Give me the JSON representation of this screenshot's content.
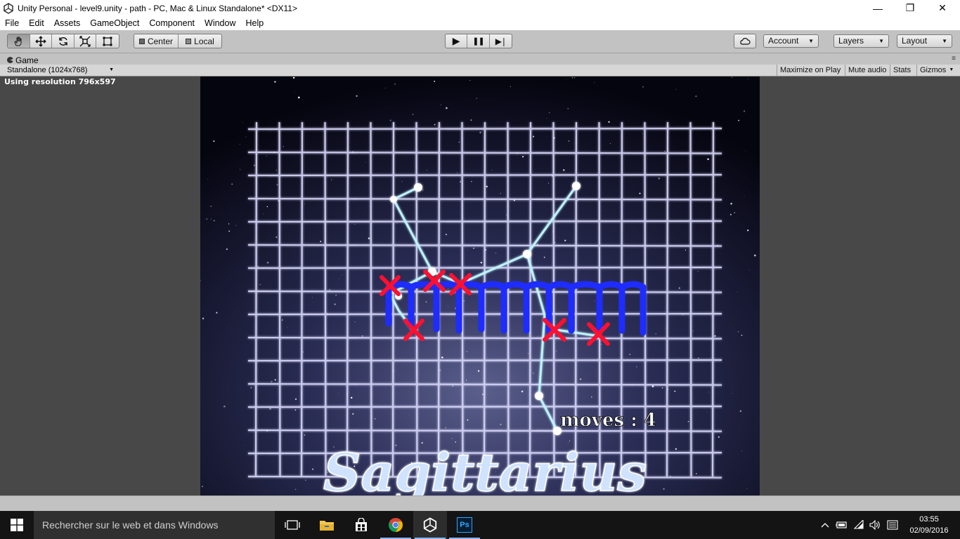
{
  "window": {
    "title": "Unity Personal - level9.unity - path - PC, Mac & Linux Standalone* <DX11>",
    "minimize": "—",
    "maximize": "❐",
    "close": "✕"
  },
  "menu": [
    "File",
    "Edit",
    "Assets",
    "GameObject",
    "Component",
    "Window",
    "Help"
  ],
  "toolbar": {
    "tools": [
      "hand-icon",
      "move-icon",
      "rotate-icon",
      "scale-icon",
      "rect-icon"
    ],
    "pivot_label": "Center",
    "space_label": "Local",
    "play": "▶",
    "pause": "❚❚",
    "step": "▶❘",
    "account_label": "Account",
    "layers_label": "Layers",
    "layout_label": "Layout"
  },
  "tab": {
    "label": "Game"
  },
  "gamebar": {
    "resolution_option": "Standalone (1024x768)",
    "maximize_on_play": "Maximize on Play",
    "mute_audio": "Mute audio",
    "stats": "Stats",
    "gizmos": "Gizmos"
  },
  "viewport": {
    "resolution_text": "Using resolution 796x597",
    "moves_text": "moves : 4",
    "constellation_title": "Sagittarius"
  },
  "taskbar": {
    "search_placeholder": "Rechercher sur le web et dans Windows",
    "apps": [
      "task-view-icon",
      "file-explorer-icon",
      "store-icon",
      "chrome-icon",
      "unity-icon",
      "photoshop-icon"
    ],
    "photoshop_label": "Ps",
    "time": "03:55",
    "date": "02/09/2016"
  },
  "colors": {
    "editor_gray": "#c2c2c2",
    "path_blue": "#1e2cff",
    "cross_red": "#ff1030",
    "constellation_line": "#bff3ff"
  }
}
